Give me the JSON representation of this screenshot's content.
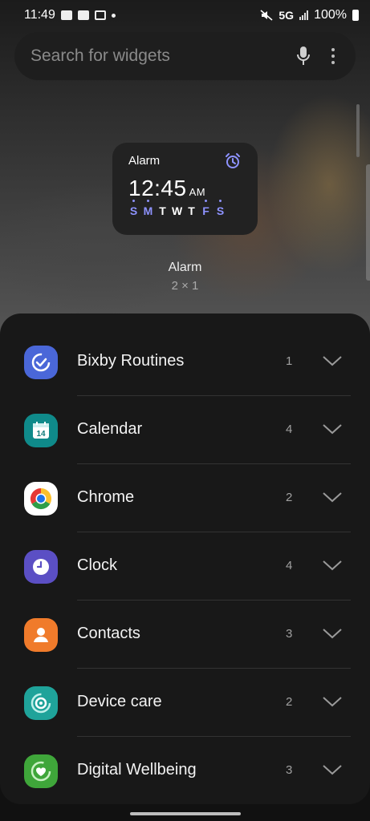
{
  "status_bar": {
    "time": "11:49",
    "network": "5G",
    "battery": "100%"
  },
  "search": {
    "placeholder": "Search for widgets"
  },
  "widget_preview": {
    "card_title": "Alarm",
    "time": "12:45",
    "ampm": "AM",
    "days": [
      {
        "letter": "S",
        "active": true
      },
      {
        "letter": "M",
        "active": true
      },
      {
        "letter": "T",
        "active": false
      },
      {
        "letter": "W",
        "active": false
      },
      {
        "letter": "T",
        "active": false
      },
      {
        "letter": "F",
        "active": true
      },
      {
        "letter": "S",
        "active": true
      }
    ],
    "name": "Alarm",
    "size": "2 × 1"
  },
  "apps": [
    {
      "label": "Bixby Routines",
      "count": "1",
      "icon": "bixby-routines-icon",
      "color": "#4a67d8"
    },
    {
      "label": "Calendar",
      "count": "4",
      "icon": "calendar-icon",
      "color": "#0f8a8a",
      "icon_text": "14"
    },
    {
      "label": "Chrome",
      "count": "2",
      "icon": "chrome-icon",
      "color": "#ffffff"
    },
    {
      "label": "Clock",
      "count": "4",
      "icon": "clock-icon",
      "color": "#5b4fc4"
    },
    {
      "label": "Contacts",
      "count": "3",
      "icon": "contacts-icon",
      "color": "#f07b2b"
    },
    {
      "label": "Device care",
      "count": "2",
      "icon": "device-care-icon",
      "color": "#1fa39a"
    },
    {
      "label": "Digital Wellbeing",
      "count": "3",
      "icon": "digital-wellbeing-icon",
      "color": "#3fa63a"
    }
  ],
  "colors": {
    "accent": "#8e93ff",
    "sheet_background": "#181818"
  }
}
